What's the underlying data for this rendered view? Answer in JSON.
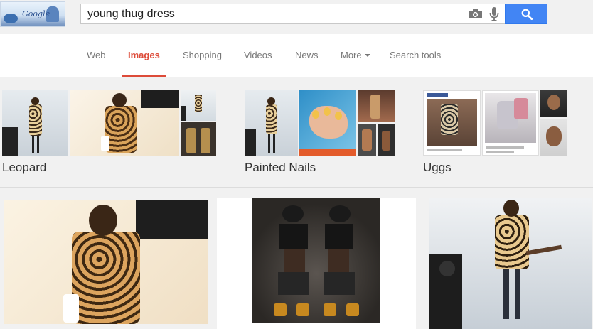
{
  "search": {
    "query": "young thug dress"
  },
  "icons": {
    "camera": "camera-icon",
    "mic": "microphone-icon",
    "search": "search-icon",
    "caret": "caret-down-icon"
  },
  "colors": {
    "accent_active_tab": "#dd4b39",
    "search_button": "#4285f4",
    "background": "#f1f1f1"
  },
  "nav": {
    "tabs": [
      {
        "label": "Web"
      },
      {
        "label": "Images"
      },
      {
        "label": "Shopping"
      },
      {
        "label": "Videos"
      },
      {
        "label": "News"
      },
      {
        "label": "More"
      },
      {
        "label": "Search tools"
      }
    ],
    "active_tab": "Images"
  },
  "related_searches": [
    {
      "label": "Leopard"
    },
    {
      "label": "Painted Nails"
    },
    {
      "label": "Uggs"
    }
  ]
}
